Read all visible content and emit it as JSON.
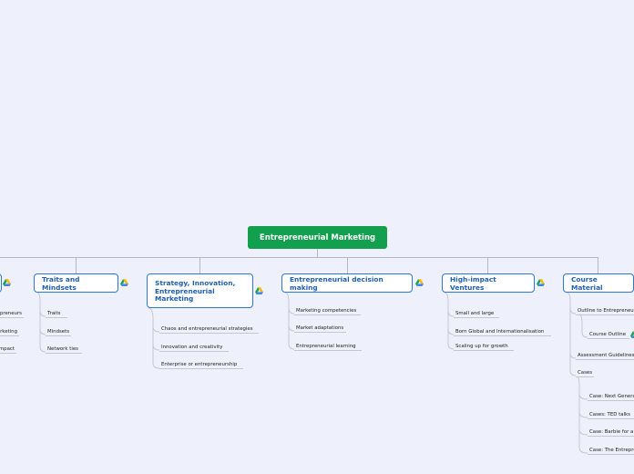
{
  "root": {
    "label": "Entrepreneurial Marketing"
  },
  "branches": [
    {
      "label": "",
      "children": [
        "Entrepreneurs",
        "Marketing",
        "Impact"
      ]
    },
    {
      "label": "Traits and Mindsets",
      "children": [
        "Traits",
        "Mindsets",
        "Network ties"
      ]
    },
    {
      "label": "Strategy, Innovation, Entrepreneurial Marketing",
      "children": [
        "Chaos and entrepreneurial strategies",
        "Innovation and creativity",
        "Enterprise or entrepreneurship"
      ]
    },
    {
      "label": "Entrepreneurial decision making",
      "children": [
        "Marketing competencies",
        "Market adaptations",
        "Entrepreneurial learning"
      ]
    },
    {
      "label": "High-impact Ventures",
      "children": [
        "Small and large",
        "Born Global and Internationalisation",
        "Scaling up for growth"
      ]
    },
    {
      "label": "Course Material",
      "children": [
        "Outline to Entrepreneurial Marketing",
        "Course Outline",
        "Assessment Guidelines",
        "Cases",
        "Case: Next Generation",
        "Cases: TED talks",
        "Case: Barbie for a day",
        "Case: The Entrepreneur"
      ]
    }
  ],
  "icons": {
    "attachment": "google-drive-icon"
  },
  "colors": {
    "root": "#12a04f",
    "topic_border": "#2a78d4",
    "topic_text": "#1e5fb3",
    "background": "#eef1fb"
  }
}
